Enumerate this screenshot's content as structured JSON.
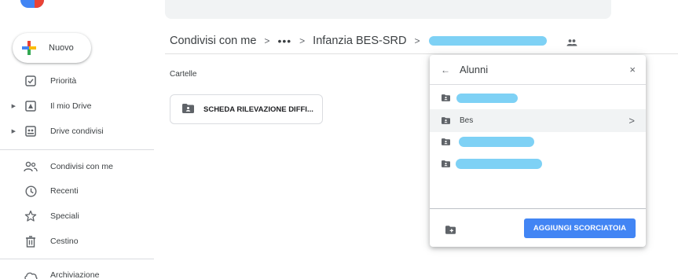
{
  "sidebar": {
    "new_label": "Nuovo",
    "items": [
      {
        "label": "Priorità",
        "icon": "checkbox-icon"
      },
      {
        "label": "Il mio Drive",
        "icon": "drive-icon"
      },
      {
        "label": "Drive condivisi",
        "icon": "shared-drive-icon"
      },
      {
        "label": "Condivisi con me",
        "icon": "people-icon"
      },
      {
        "label": "Recenti",
        "icon": "clock-icon"
      },
      {
        "label": "Speciali",
        "icon": "star-icon"
      },
      {
        "label": "Cestino",
        "icon": "trash-icon"
      },
      {
        "label": "Archiviazione",
        "icon": "cloud-icon"
      }
    ]
  },
  "breadcrumb": {
    "root": "Condivisi con me",
    "ellipsis": "•••",
    "folder": "Infanzia BES-SRD",
    "separator": ">"
  },
  "main": {
    "section_label": "Cartelle",
    "folder_name": "SCHEDA RILEVAZIONE DIFFI..."
  },
  "dialog": {
    "back": "←",
    "title": "Alunni",
    "close": "×",
    "rows": [
      {
        "label": "",
        "redacted": true
      },
      {
        "label": "Bes",
        "redacted": false,
        "chevron": ">"
      },
      {
        "label": "",
        "redacted": true
      },
      {
        "label": "",
        "redacted": true
      }
    ],
    "add_button": "AGGIUNGI SCORCIATOIA"
  },
  "colors": {
    "accent": "#4285f4",
    "redaction": "#7ed1f5"
  }
}
